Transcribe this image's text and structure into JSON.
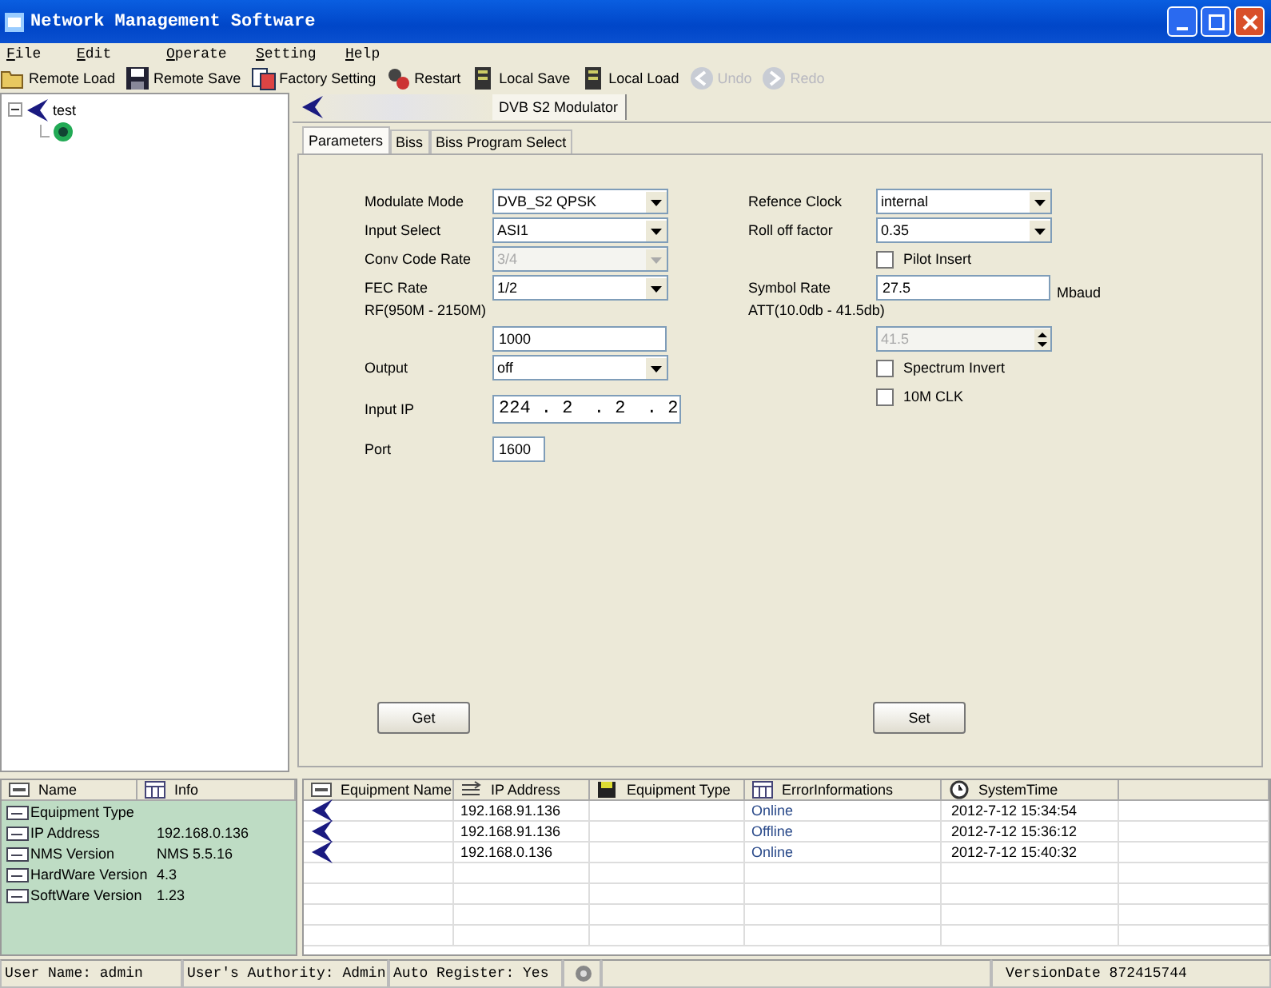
{
  "window": {
    "title": "Network Management Software"
  },
  "menu": [
    {
      "label": "File"
    },
    {
      "label": "Edit"
    },
    {
      "label": "Operate"
    },
    {
      "label": "Setting"
    },
    {
      "label": "Help"
    }
  ],
  "toolbar": [
    {
      "label": "Remote Load",
      "disabled": false
    },
    {
      "label": "Remote Save",
      "disabled": false
    },
    {
      "label": "Factory Setting",
      "disabled": false
    },
    {
      "label": "Restart",
      "disabled": false
    },
    {
      "label": "Local Save",
      "disabled": false
    },
    {
      "label": "Local Load",
      "disabled": false
    },
    {
      "label": "Undo",
      "disabled": true
    },
    {
      "label": "Redo",
      "disabled": true
    }
  ],
  "tree": [
    {
      "label": "test",
      "expanded": true,
      "children": [
        {
          "kind": "device"
        }
      ]
    }
  ],
  "device_tabs": [
    {
      "label": "DVB S2 Modulator",
      "selected": true
    }
  ],
  "tabs": [
    {
      "label": "Parameters",
      "selected": true
    },
    {
      "label": "Biss",
      "selected": false
    },
    {
      "label": "Biss Program Select",
      "selected": false
    }
  ],
  "form_left": [
    {
      "kind": "select",
      "label": "Modulate Mode",
      "value": "DVB_S2 QPSK",
      "disabled": false
    },
    {
      "kind": "select",
      "label": "Input Select",
      "value": "ASI1",
      "disabled": false
    },
    {
      "kind": "select",
      "label": "Conv Code Rate",
      "value": "3/4",
      "disabled": true
    },
    {
      "kind": "select",
      "label": "FEC Rate",
      "value": "1/2",
      "disabled": false
    },
    {
      "kind": "label",
      "label": "RF(950M - 2150M)"
    },
    {
      "kind": "input",
      "value": "1000",
      "disabled": false
    },
    {
      "kind": "select",
      "label": "Output",
      "value": "off",
      "disabled": false
    },
    {
      "kind": "ip",
      "label": "Input IP",
      "value": "224 . 2  . 2  . 2"
    },
    {
      "kind": "short",
      "label": "Port",
      "value": "1600"
    }
  ],
  "form_right": [
    {
      "kind": "select",
      "label": "Refence Clock",
      "value": "internal",
      "disabled": false
    },
    {
      "kind": "select",
      "label": "Roll off factor",
      "value": "0.35",
      "disabled": false
    },
    {
      "kind": "checkbox",
      "label": "Pilot Insert",
      "checked": false
    },
    {
      "kind": "input",
      "label": "Symbol Rate",
      "value": "27.5",
      "unit": "Mbaud",
      "disabled": false
    },
    {
      "kind": "label",
      "label": "ATT(10.0db - 41.5db)"
    },
    {
      "kind": "spin",
      "value": "41.5",
      "disabled": true
    },
    {
      "kind": "checkbox",
      "label": "Spectrum Invert",
      "checked": false
    },
    {
      "kind": "checkbox",
      "label": "10M CLK",
      "checked": false
    }
  ],
  "buttons": [
    {
      "label": "Get"
    },
    {
      "label": "Set"
    }
  ],
  "info_table": {
    "columns": [
      "Name",
      "Info"
    ],
    "rows": [
      [
        "Equipment Type"
      ],
      [
        "IP Address",
        "192.168.0.136"
      ],
      [
        "NMS Version",
        "NMS 5.5.16"
      ],
      [
        "HardWare Version",
        "4.3"
      ],
      [
        "SoftWare Version",
        "1.23"
      ]
    ]
  },
  "equipment_table": {
    "columns": [
      "Equipment Name",
      "IP Address",
      "Equipment Type",
      "ErrorInformations",
      "SystemTime"
    ],
    "rows": [
      {
        "ip": "192.168.91.136",
        "status": "Online",
        "time": "2012-7-12 15:34:54"
      },
      {
        "ip": "192.168.91.136",
        "status": "Offline",
        "time": "2012-7-12 15:36:12"
      },
      {
        "ip": "192.168.0.136",
        "status": "Online",
        "time": "2012-7-12 15:40:32"
      }
    ]
  },
  "status_bar": [
    "User Name: admin",
    "User's Authority: Admin",
    "Auto Register: Yes",
    "VersionDate  872415744"
  ]
}
